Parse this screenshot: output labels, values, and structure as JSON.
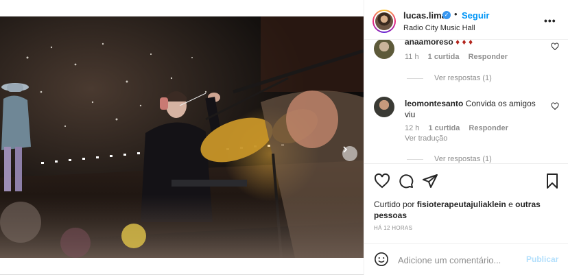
{
  "post": {
    "username": "lucas.lima",
    "separator": "•",
    "follow_label": "Seguir",
    "location": "Radio City Music Hall",
    "more_label": "•••",
    "colors": {
      "accent": "#0095f6",
      "verified": "#3897f0",
      "publish_disabled": "#b2dffc"
    }
  },
  "carousel": {
    "slide_count": 5,
    "active_slide": 1,
    "next_icon": "chevron-right-icon"
  },
  "comments": [
    {
      "username": "anaamoreso",
      "text": "♦ ♦ ♦",
      "time": "11 h",
      "likes": "1 curtida",
      "reply_label": "Responder",
      "view_replies": "Ver respostas (1)"
    },
    {
      "username": "leomontesanto",
      "text": "Convida os amigos viu",
      "time": "12 h",
      "likes": "1 curtida",
      "reply_label": "Responder",
      "translate_label": "Ver tradução",
      "view_replies": "Ver respostas (1)"
    }
  ],
  "actions": {
    "icons": [
      "heart-icon",
      "comment-icon",
      "share-icon",
      "bookmark-icon"
    ],
    "liked_by_prefix": "Curtido por",
    "liked_by_user": "fisioterapeutajuliaklein",
    "liked_by_connector": "e",
    "liked_by_others": "outras pessoas",
    "time_ago": "HÁ 12 HORAS"
  },
  "add_comment": {
    "placeholder": "Adicione um comentário...",
    "publish_label": "Publicar",
    "emoji_icon": "emoji-icon"
  }
}
